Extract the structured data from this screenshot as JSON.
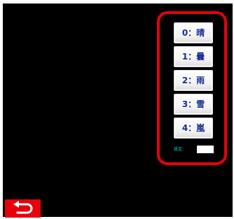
{
  "options": [
    {
      "label": "0：晴"
    },
    {
      "label": "1：曇"
    },
    {
      "label": "2：雨"
    },
    {
      "label": "3：雪"
    },
    {
      "label": "4：嵐"
    }
  ],
  "setting": {
    "label": "設定:",
    "value": ""
  },
  "colors": {
    "screen_background": "#000000",
    "highlight": "#e8000b",
    "button_text": "#1a2f92",
    "setting_label": "#26c0d9",
    "back_button": "#e8000b"
  },
  "icons": {
    "back": "return-arrow-icon"
  }
}
